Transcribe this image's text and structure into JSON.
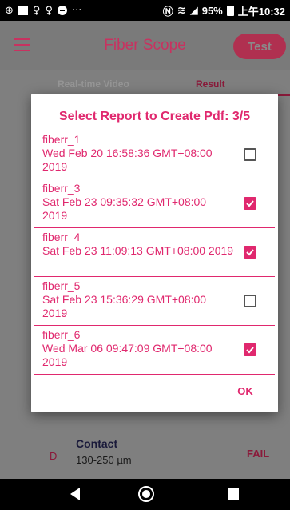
{
  "status_bar": {
    "left_icons": [
      "app-icon",
      "notification-square-icon",
      "hotspot-icon",
      "hotspot-icon",
      "do-not-disturb-icon",
      "more-icon"
    ],
    "overflow": "···",
    "battery": "95%",
    "time": "上午10:32"
  },
  "app_bar": {
    "title": "Fiber Scope",
    "test_label": "Test"
  },
  "tabs": [
    {
      "label": "Real-time Video"
    },
    {
      "label": "Result"
    }
  ],
  "background_row": {
    "grade": "D",
    "zone": "Contact",
    "range": "130-250 µm",
    "status": "FAIL"
  },
  "dialog": {
    "title": "Select Report to Create Pdf: 3/5",
    "items": [
      {
        "name": "fiberr_1",
        "date": "Wed Feb 20 16:58:36 GMT+08:00 2019",
        "checked": false
      },
      {
        "name": "fiberr_3",
        "date": "Sat Feb 23 09:35:32 GMT+08:00 2019",
        "checked": true
      },
      {
        "name": "fiberr_4",
        "date": "Sat Feb 23 11:09:13 GMT+08:00 2019",
        "checked": true
      },
      {
        "name": "fiberr_5",
        "date": "Sat Feb 23 15:36:29 GMT+08:00 2019",
        "checked": false
      },
      {
        "name": "fiberr_6",
        "date": "Wed Mar 06 09:47:09 GMT+08:00 2019",
        "checked": true
      }
    ],
    "ok_label": "OK"
  },
  "colors": {
    "accent": "#e0286e",
    "overlay": "#7f7f7f"
  }
}
